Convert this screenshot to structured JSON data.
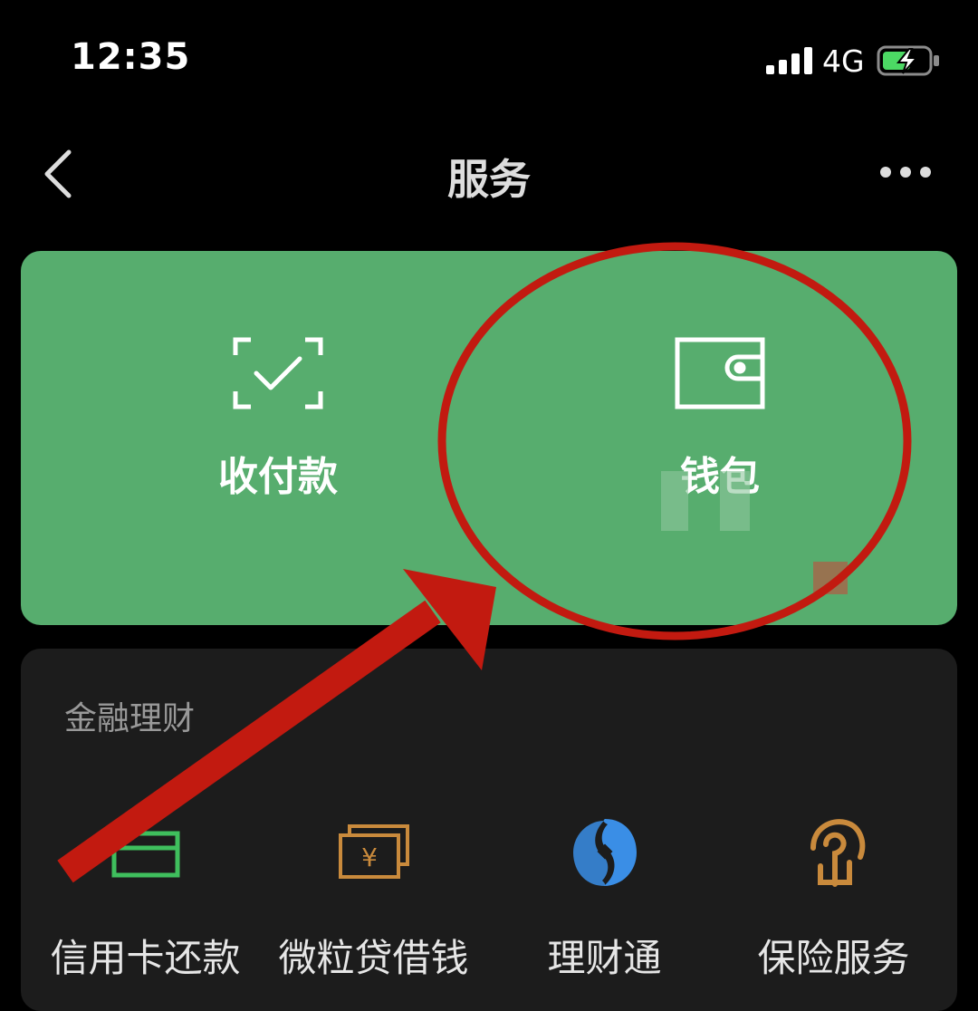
{
  "status_bar": {
    "time": "12:35",
    "network": "4G"
  },
  "nav": {
    "title": "服务"
  },
  "primary_services": [
    {
      "label": "收付款",
      "icon": "scan-check-icon"
    },
    {
      "label": "钱包",
      "icon": "wallet-icon"
    }
  ],
  "finance": {
    "title": "金融理财",
    "items": [
      {
        "label": "信用卡还款",
        "icon": "credit-card-icon"
      },
      {
        "label": "微粒贷借钱",
        "icon": "yuan-banknote-icon"
      },
      {
        "label": "理财通",
        "icon": "licaitong-icon"
      },
      {
        "label": "保险服务",
        "icon": "insurance-icon"
      }
    ]
  },
  "colors": {
    "background": "#000000",
    "brand_green": "#57ad6e",
    "card_dark": "#1c1c1c",
    "annotation_red": "#c21a10",
    "credit_card_icon": "#3fbf5d",
    "yuan_icon": "#c98a3c",
    "licaitong_icon": "#3a8ee6",
    "insurance_icon": "#c98a3c"
  }
}
